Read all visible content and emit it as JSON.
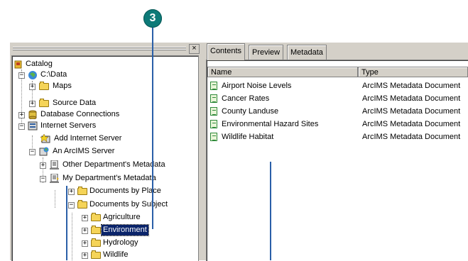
{
  "callout": {
    "number": "3"
  },
  "tree": {
    "items": [
      {
        "label": "Catalog"
      },
      {
        "label": "C:\\Data"
      },
      {
        "label": "Maps"
      },
      {
        "label": "Source Data"
      },
      {
        "label": "Database Connections"
      },
      {
        "label": "Internet Servers"
      },
      {
        "label": "Add Internet Server"
      },
      {
        "label": "An ArcIMS Server"
      },
      {
        "label": "Other Department's Metadata"
      },
      {
        "label": "My Department's Metadata"
      },
      {
        "label": "Documents by Place"
      },
      {
        "label": "Documents by Subject"
      },
      {
        "label": "Agriculture"
      },
      {
        "label": "Environment"
      },
      {
        "label": "Hydrology"
      },
      {
        "label": "Wildlife"
      }
    ],
    "close_glyph": "×"
  },
  "tabs": [
    {
      "label": "Contents"
    },
    {
      "label": "Preview"
    },
    {
      "label": "Metadata"
    }
  ],
  "table": {
    "columns": [
      "Name",
      "Type"
    ],
    "rows": [
      {
        "name": "Airport Noise Levels",
        "type": "ArcIMS Metadata Document"
      },
      {
        "name": "Cancer Rates",
        "type": "ArcIMS Metadata Document"
      },
      {
        "name": "County Landuse",
        "type": "ArcIMS Metadata Document"
      },
      {
        "name": "Environmental Hazard Sites",
        "type": "ArcIMS Metadata Document"
      },
      {
        "name": "Wildlife Habitat",
        "type": "ArcIMS Metadata Document"
      }
    ]
  },
  "colors": {
    "selection": "#0a246a",
    "callout": "#0d7a78",
    "callout_line": "#2a5fa8",
    "folder": "#f5d458"
  }
}
